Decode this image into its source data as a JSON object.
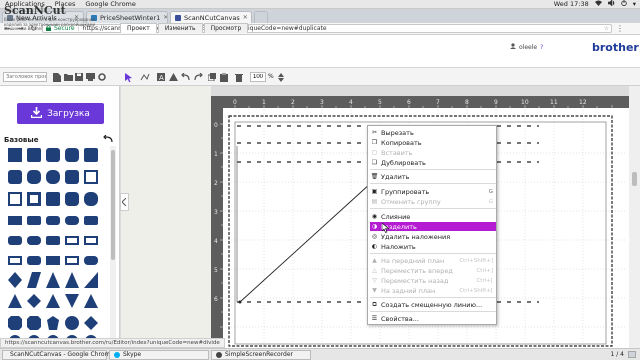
{
  "topbar": {
    "menus": [
      "Applications",
      "Places",
      "Google Chrome"
    ],
    "clock": "Wed 17:38",
    "indicators": [
      "wifi-icon",
      "volume-icon",
      "power-icon",
      "chevron-down-icon"
    ]
  },
  "browser": {
    "tabs": [
      {
        "label": "New Arrivals",
        "active": false
      },
      {
        "label": "PriceSheetWinter1",
        "active": false
      },
      {
        "label": "ScanNCutCanvas",
        "active": true
      }
    ],
    "address": {
      "secure_label": "Secure",
      "url": "https://scanncutcanvas.brother.com/ru/Editor/index?uniqueCode=new#duplicate"
    }
  },
  "app": {
    "logo": "ScanNCut",
    "logo_tagline": "Ваше рабочее место для конструирования изделий за электронными раскройщиками машинами Brother",
    "menu_tabs": [
      "Проект",
      "Изменить",
      "Просмотр"
    ],
    "user": "oleele",
    "brand": "brother",
    "search_placeholder": "Заголовок прое",
    "zoom_value": "100",
    "zoom_unit": "%",
    "upload_label": "Загрузка",
    "basic_label": "Базовые",
    "ruler_top": [
      "0",
      "1",
      "2",
      "3",
      "4",
      "5",
      "6",
      "7",
      "8",
      "9",
      "10",
      "11",
      "12"
    ],
    "ruler_left": [
      "0",
      "1",
      "2",
      "3",
      "4",
      "5",
      "6"
    ]
  },
  "context_menu": {
    "items": [
      {
        "label": "Вырезать",
        "shortcut": "",
        "disabled": false,
        "icon": "scissors-icon"
      },
      {
        "label": "Копировать",
        "shortcut": "",
        "disabled": false,
        "icon": "copy-icon"
      },
      {
        "label": "Вставить",
        "shortcut": "",
        "disabled": true,
        "icon": "paste-icon"
      },
      {
        "label": "Дублировать",
        "shortcut": "",
        "disabled": false,
        "icon": "duplicate-icon"
      },
      {
        "label": "Удалить",
        "shortcut": "",
        "disabled": false,
        "icon": "trash-icon"
      },
      {
        "label": "Группировать",
        "shortcut": "G",
        "disabled": false,
        "icon": "group-icon"
      },
      {
        "label": "Отменить группу",
        "shortcut": "G",
        "disabled": true,
        "icon": "ungroup-icon"
      },
      {
        "label": "Слияние",
        "shortcut": "",
        "disabled": false,
        "icon": "merge-icon"
      },
      {
        "label": "Разделить",
        "shortcut": "",
        "disabled": false,
        "icon": "split-icon",
        "highlighted": true
      },
      {
        "label": "Удалить наложения",
        "shortcut": "",
        "disabled": false,
        "icon": "remove-overlap-icon"
      },
      {
        "label": "Наложить",
        "shortcut": "",
        "disabled": false,
        "icon": "overlap-icon"
      },
      {
        "label": "На передний план",
        "shortcut": "Ctrl+Shift+]",
        "disabled": true,
        "icon": "front-icon"
      },
      {
        "label": "Переместить вперед",
        "shortcut": "Ctrl+]",
        "disabled": true,
        "icon": "forward-icon"
      },
      {
        "label": "Переместить назад",
        "shortcut": "Ctrl+[",
        "disabled": true,
        "icon": "backward-icon"
      },
      {
        "label": "На задний план",
        "shortcut": "Ctrl+Shift+[",
        "disabled": true,
        "icon": "back-icon"
      },
      {
        "label": "Создать смещенную линию...",
        "shortcut": "",
        "disabled": false,
        "icon": "offset-line-icon"
      },
      {
        "label": "Свойства...",
        "shortcut": "",
        "disabled": false,
        "icon": "properties-icon"
      }
    ]
  },
  "status_url": "https://scanncutcanvas.brother.com/ru/Editor/index?uniqueCode=new#divide",
  "taskbar": {
    "tasks": [
      "ScanNCutCanvas - Google Chrome",
      "Skype",
      "SimpleScreenRecorder"
    ],
    "pager": "1 / 4"
  },
  "colors": {
    "accent": "#6a37d8",
    "highlight": "#b51bd3",
    "shape_fill": "#1f3f78",
    "brand": "#1f3b9a"
  }
}
